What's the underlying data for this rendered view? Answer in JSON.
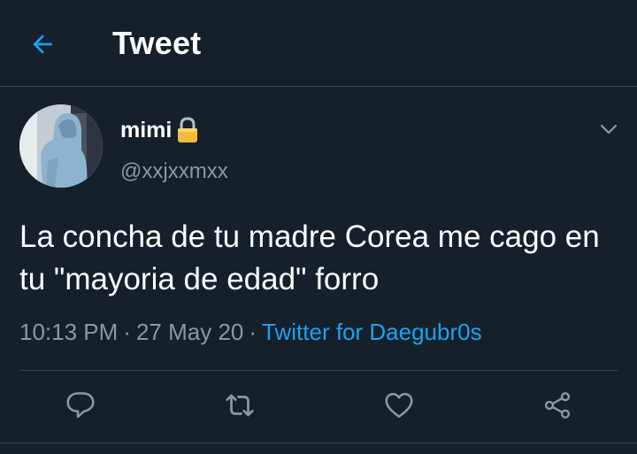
{
  "header": {
    "title": "Tweet",
    "back_icon": "arrow-left-icon"
  },
  "tweet": {
    "display_name": "mimi",
    "protected_icon": "lock-icon",
    "username": "@xxjxxmxx",
    "text": "La concha de tu madre Corea me cago en tu \"mayoria de edad\" forro",
    "time": "10:13 PM",
    "date": "27 May 20",
    "source": "Twitter for Daegubr0s",
    "menu_icon": "chevron-down-icon"
  },
  "actions": [
    {
      "name": "reply",
      "icon": "speech-bubble-icon"
    },
    {
      "name": "retweet",
      "icon": "retweet-icon"
    },
    {
      "name": "like",
      "icon": "heart-icon"
    },
    {
      "name": "share",
      "icon": "share-icon"
    }
  ],
  "colors": {
    "background": "#15202b",
    "accent": "#1da1f2",
    "secondary_text": "#8899a6",
    "border": "#38444d"
  }
}
